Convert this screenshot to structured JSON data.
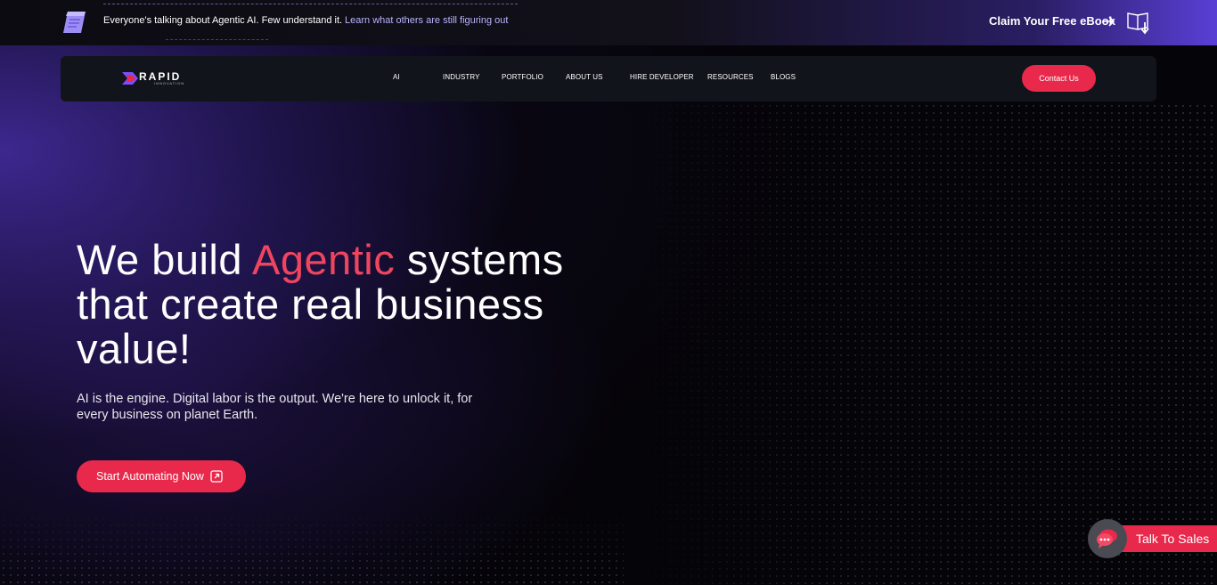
{
  "announcement": {
    "text": "Everyone's talking about Agentic AI. Few understand it.",
    "link": "Learn what others are still figuring out",
    "cta": "Claim Your Free eBook",
    "icons": [
      "book-icon",
      "arrow-right-icon",
      "ebook-download-icon"
    ]
  },
  "brand": {
    "name": "RAPID",
    "tagline": "INNOVATION"
  },
  "nav": {
    "items": [
      "AI",
      "INDUSTRY",
      "PORTFOLIO",
      "ABOUT US",
      "HIRE DEVELOPER",
      "RESOURCES",
      "BLOGS"
    ],
    "contact": "Contact Us"
  },
  "hero": {
    "title_before": "We build ",
    "title_accent": "Agentic",
    "title_after": " systems that create real business value!",
    "subtitle": "AI is the engine. Digital labor is the output. We're here to unlock it, for every business on planet Earth.",
    "cta": "Start Automating Now"
  },
  "sales": {
    "label": "Talk To Sales"
  },
  "colors": {
    "accent": "#e8294b",
    "accent_text": "#f0455f",
    "link": "#b9b3ff",
    "nav_bg": "#12141c",
    "purple_glow": "#5537c8"
  }
}
